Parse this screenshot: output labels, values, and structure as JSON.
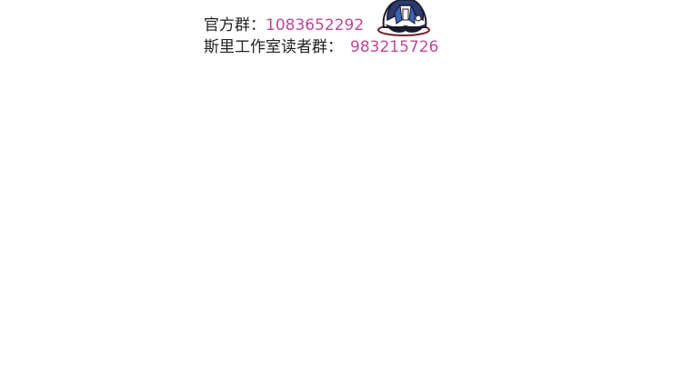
{
  "groups": {
    "official_label": "官方群：",
    "official_number": "1083652292",
    "reader_label": "斯里工作室读者群：",
    "reader_number": "983215726"
  },
  "mascot": {
    "icon": "chibi-character-icon",
    "colors": {
      "hair": "#2c3a6e",
      "clothes": "#3d63b8",
      "outline": "#1a1a2e",
      "accent": "#7a1f2a"
    }
  },
  "colors": {
    "text": "#222222",
    "number": "#c2459a",
    "background": "#ffffff"
  }
}
